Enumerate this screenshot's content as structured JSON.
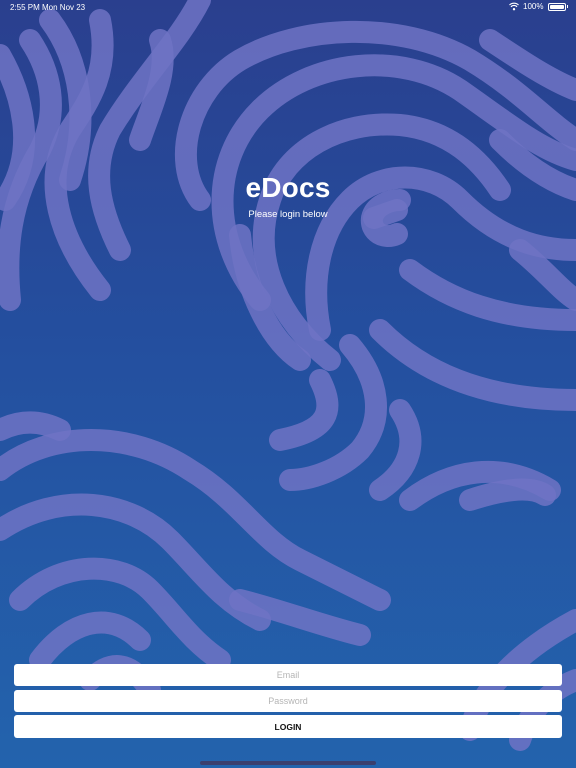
{
  "status_bar": {
    "time": "2:55 PM",
    "date": "Mon Nov 23",
    "battery": "100%"
  },
  "app": {
    "title": "eDocs",
    "subtitle": "Please login below"
  },
  "login_form": {
    "email_placeholder": "Email",
    "password_placeholder": "Password",
    "login_label": "LOGIN"
  },
  "colors": {
    "background_top": "#2a3f8e",
    "background_bottom": "#2363ad",
    "swirl": "#6f73c4",
    "field": "#ffffff"
  }
}
